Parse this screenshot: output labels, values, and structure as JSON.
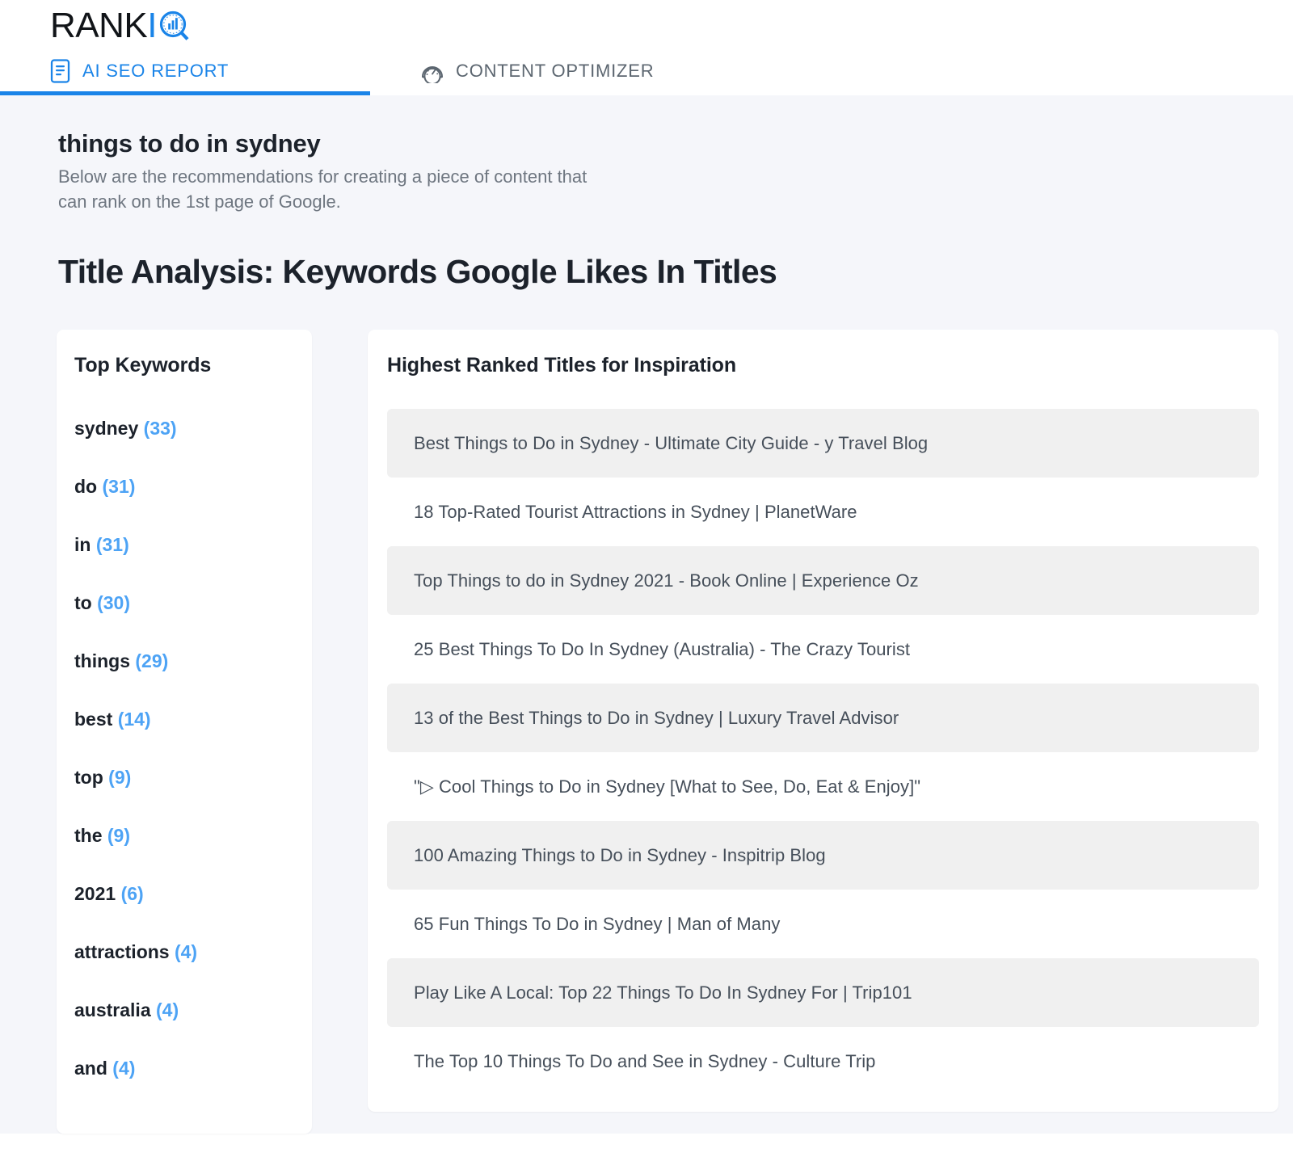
{
  "brand": {
    "name_prefix": "RANK",
    "name_suffix": "IQ",
    "logo_icon": "magnifier-bar-chart-icon"
  },
  "tabs": [
    {
      "label": "AI SEO REPORT",
      "icon": "document-report-icon",
      "active": true
    },
    {
      "label": "CONTENT OPTIMIZER",
      "icon": "speedometer-gauge-icon",
      "active": false
    }
  ],
  "header": {
    "keyword": "things to do in sydney",
    "description_line1": "Below are the recommendations for creating a piece of content that",
    "description_line2": "can rank on the 1st page of Google."
  },
  "section": {
    "title": "Title Analysis: Keywords Google Likes In Titles"
  },
  "keywords_card": {
    "heading": "Top Keywords",
    "items": [
      {
        "word": "sydney",
        "count": "(33)"
      },
      {
        "word": "do",
        "count": "(31)"
      },
      {
        "word": "in",
        "count": "(31)"
      },
      {
        "word": "to",
        "count": "(30)"
      },
      {
        "word": "things",
        "count": "(29)"
      },
      {
        "word": "best",
        "count": "(14)"
      },
      {
        "word": "top",
        "count": "(9)"
      },
      {
        "word": "the",
        "count": "(9)"
      },
      {
        "word": "2021",
        "count": "(6)"
      },
      {
        "word": "attractions",
        "count": "(4)"
      },
      {
        "word": "australia",
        "count": "(4)"
      },
      {
        "word": "and",
        "count": "(4)"
      }
    ]
  },
  "titles_card": {
    "heading": "Highest Ranked Titles for Inspiration",
    "items": [
      "Best Things to Do in Sydney - Ultimate City Guide - y Travel Blog",
      "18 Top-Rated Tourist Attractions in Sydney | PlanetWare",
      "Top Things to do in Sydney 2021 - Book Online | Experience Oz",
      "25 Best Things To Do In Sydney (Australia) - The Crazy Tourist",
      "13 of the Best Things to Do in Sydney | Luxury Travel Advisor",
      "\"▷ Cool Things to Do in Sydney [What to See, Do, Eat & Enjoy]\"",
      "100 Amazing Things to Do in Sydney - Inspitrip Blog",
      "65 Fun Things To Do in Sydney | Man of Many",
      "Play Like A Local: Top 22 Things To Do In Sydney For | Trip101",
      "The Top 10 Things To Do and See in Sydney - Culture Trip"
    ]
  },
  "colors": {
    "accent_blue": "#1a84e8",
    "count_blue": "#4da3f5",
    "page_background": "#f5f6fa",
    "row_shade": "#f0f0f0",
    "text_dark": "#1c222b",
    "text_muted": "#6e7680"
  }
}
